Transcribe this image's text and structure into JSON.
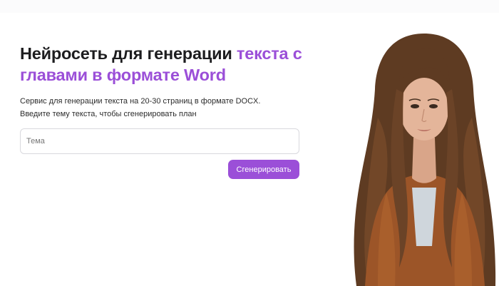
{
  "hero": {
    "title_part1": "Нейросеть для генерации ",
    "title_accent": "текста с главами в формате Word",
    "subtitle_line1": "Сервис для генерации текста на 20-30 страниц в формате DOCX.",
    "subtitle_line2": "Введите тему текста, чтобы сгенерировать план"
  },
  "form": {
    "topic_placeholder": "Тема",
    "topic_value": "",
    "generate_label": "Сгенерировать"
  },
  "colors": {
    "accent": "#9b4fd8",
    "heading": "#1d1d1f",
    "text": "#2b2b2b",
    "input_border": "#d9d9de"
  },
  "image": {
    "icon": "woman-portrait-image"
  }
}
